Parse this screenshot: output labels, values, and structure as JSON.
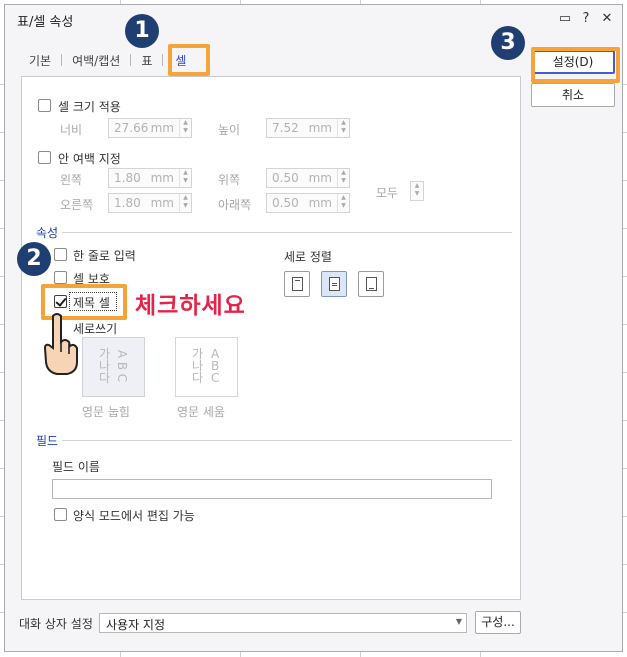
{
  "dialog": {
    "title": "표/셀 속성",
    "title_buttons": [
      "▭",
      "?",
      "✕"
    ]
  },
  "tabs": [
    "기본",
    "여백/캡션",
    "표",
    "셀"
  ],
  "active_tab": "셀",
  "buttons": {
    "ok": "설정(D)",
    "cancel": "취소",
    "configure": "구성..."
  },
  "cell_size": {
    "apply_label": "셀 크기 적용",
    "width_label": "너비",
    "width_value": "27.66",
    "width_unit": "mm",
    "height_label": "높이",
    "height_value": "7.52",
    "height_unit": "mm"
  },
  "inner_margin": {
    "apply_label": "안 여백 지정",
    "left_label": "왼쪽",
    "left_value": "1.80",
    "top_label": "위쪽",
    "top_value": "0.50",
    "right_label": "오른쪽",
    "right_value": "1.80",
    "bottom_label": "아래쪽",
    "bottom_value": "0.50",
    "unit": "mm",
    "all_label": "모두"
  },
  "properties": {
    "section_title": "속성",
    "single_line_label": "한 줄로 입력",
    "cell_protect_label": "셀 보호",
    "title_cell_label": "제목 셀",
    "title_cell_checked": true,
    "vertical_writing_label": "세로쓰기",
    "vertical_align_label": "세로 정렬",
    "vertical_align_selected": "middle",
    "orient_lying_label": "영문 눕힘",
    "orient_upright_label": "영문 세움",
    "orient_text": [
      "가",
      "나",
      "다"
    ],
    "orient_latin": [
      "A",
      "B",
      "C"
    ]
  },
  "field": {
    "section_title": "필드",
    "name_label": "필드 이름",
    "name_value": "",
    "form_edit_label": "양식 모드에서 편집 가능"
  },
  "footer": {
    "dialog_settings_label": "대화 상자 설정",
    "dialog_settings_value": "사용자 지정"
  },
  "annotations": {
    "step1": "1",
    "step2": "2",
    "step3": "3",
    "callout": "체크하세요"
  },
  "colors": {
    "highlight": "#f6a33a",
    "badge": "#1f3f72",
    "callout": "#e6244a",
    "accent": "#3f5fd1"
  }
}
